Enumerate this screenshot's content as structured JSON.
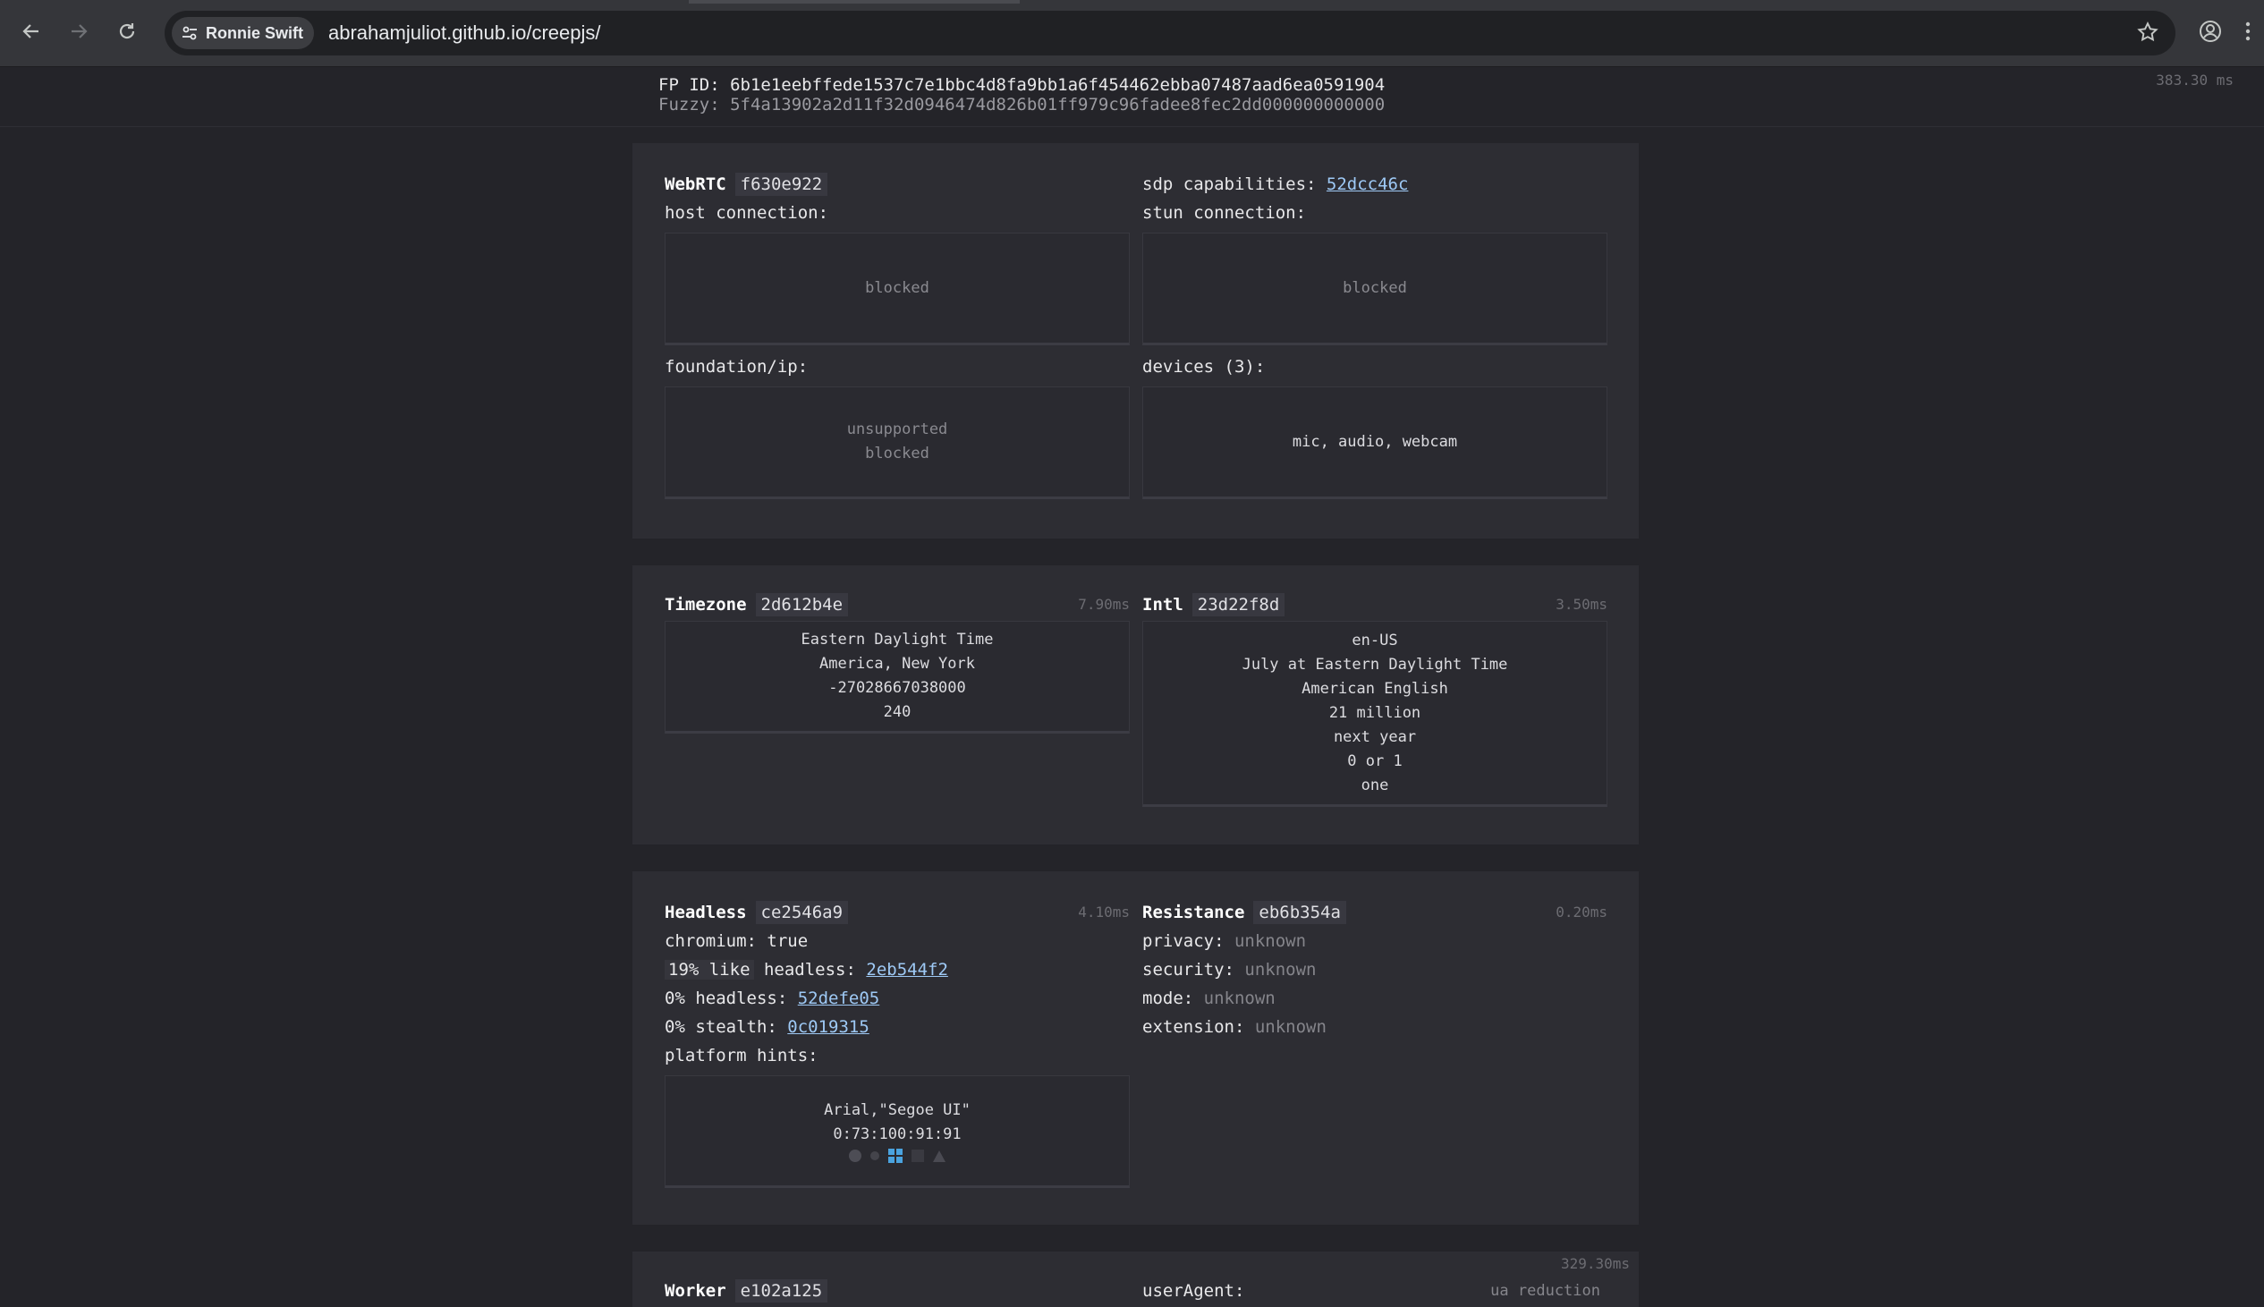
{
  "browser": {
    "profile_chip": "Ronnie Swift",
    "url": "abrahamjuliot.github.io/creepjs/"
  },
  "header": {
    "fp_id_label": "FP ID:",
    "fp_id": "6b1e1eebffede1537c7e1bbc4d8fa9bb1a6f454462ebba07487aad6ea0591904",
    "fuzzy_label": "Fuzzy:",
    "fuzzy": "5f4a13902a2d11f32d0946474d826b01ff979c96fadee8fec2dd000000000000",
    "total_time": "383.30 ms"
  },
  "webrtc": {
    "title": "WebRTC",
    "hash": "f630e922",
    "sdp_label": "sdp capabilities:",
    "sdp_hash": "52dcc46c",
    "host_label": "host connection:",
    "host_value": "blocked",
    "stun_label": "stun connection:",
    "stun_value": "blocked",
    "foundation_label": "foundation/ip:",
    "foundation_lines": [
      "unsupported",
      "blocked"
    ],
    "devices_label": "devices (3):",
    "devices_value": "mic, audio, webcam"
  },
  "timezone": {
    "title": "Timezone",
    "hash": "2d612b4e",
    "time": "7.90ms",
    "lines": [
      "Eastern Daylight Time",
      "America, New York",
      "-27028667038000",
      "240"
    ]
  },
  "intl": {
    "title": "Intl",
    "hash": "23d22f8d",
    "time": "3.50ms",
    "lines": [
      "en-US",
      "July at Eastern Daylight Time",
      "American English",
      "21 million",
      "next year",
      "0 or 1",
      "one"
    ]
  },
  "headless": {
    "title": "Headless",
    "hash": "ce2546a9",
    "time": "4.10ms",
    "chromium_label": "chromium:",
    "chromium_value": "true",
    "like_label": "19% like",
    "like_label2": "headless:",
    "like_hash": "2eb544f2",
    "headless_label": "0% headless:",
    "headless_hash": "52defe05",
    "stealth_label": "0% stealth:",
    "stealth_hash": "0c019315",
    "platform_label": "platform hints:",
    "platform_fonts": "Arial,\"Segoe UI\"",
    "platform_code": "0:73:100:91:91",
    "platform_icons": [
      "apple-icon",
      "linux-icon",
      "windows-icon",
      "chrome-os-icon",
      "android-icon"
    ]
  },
  "resistance": {
    "title": "Resistance",
    "hash": "eb6b354a",
    "time": "0.20ms",
    "privacy_label": "privacy:",
    "privacy_value": "unknown",
    "security_label": "security:",
    "security_value": "unknown",
    "mode_label": "mode:",
    "mode_value": "unknown",
    "extension_label": "extension:",
    "extension_value": "unknown"
  },
  "worker": {
    "title": "Worker",
    "hash": "e102a125",
    "time": "329.30ms",
    "ua_label": "userAgent:",
    "ua_note": "ua reduction"
  },
  "colors": {
    "background": "#242429",
    "section": "#2d2d33",
    "link": "#9ec9f5",
    "windows_accent": "#4aa3df"
  }
}
